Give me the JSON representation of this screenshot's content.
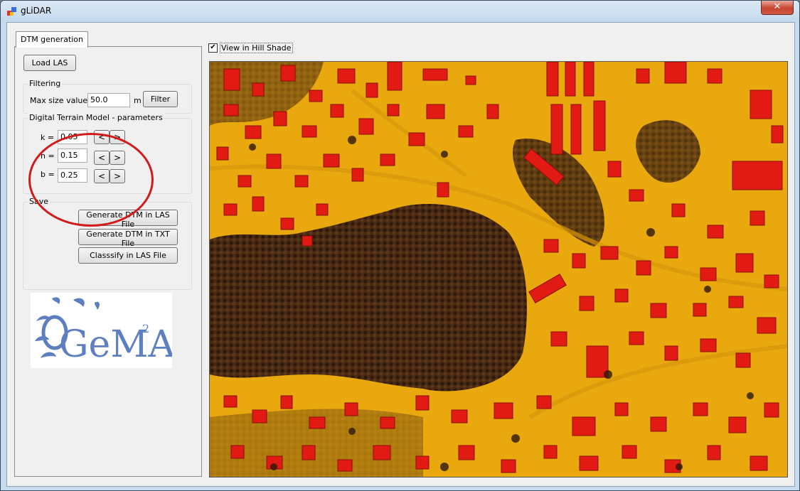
{
  "window": {
    "title": "gLiDAR",
    "close_label": "✕"
  },
  "tabs": [
    {
      "label": "DTM generation"
    }
  ],
  "load_button": "Load LAS",
  "filtering": {
    "label": "Filtering",
    "max_size_label": "Max size value",
    "max_size_value": "50.0",
    "unit": "m",
    "filter_button": "Filter"
  },
  "dtm": {
    "label": "Digital Terrain Model - parameters",
    "params": [
      {
        "name": "k =",
        "value": "0.05"
      },
      {
        "name": "n =",
        "value": "0.15"
      },
      {
        "name": "b =",
        "value": "0.25"
      }
    ],
    "decrement_label": "<",
    "increment_label": ">"
  },
  "save": {
    "label": "Save",
    "buttons": [
      "Generate DTM in LAS File",
      "Generate DTM in TXT File",
      "Classsify in LAS File"
    ]
  },
  "logo": {
    "text": "GeMA",
    "superscript": "2"
  },
  "hill_shade": {
    "label": "View in Hill Shade",
    "checked": true,
    "check_mark": "✔"
  },
  "colors": {
    "terrain": "#e9a80e",
    "buildings": "#e11b14",
    "vegetation": "#3a1f0f",
    "annotation": "#d11a1a"
  }
}
